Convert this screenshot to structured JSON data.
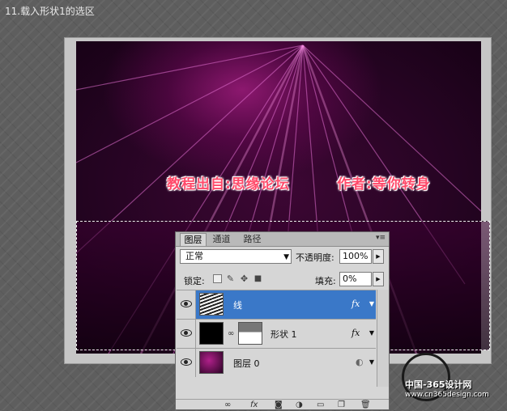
{
  "step_title": "11.载入形状1的选区",
  "canvas": {
    "caption_left": "教程出自:思缘论坛",
    "caption_right": "作者:等你转身"
  },
  "colors": {
    "canvas_dark": "#120111",
    "canvas_glow": "#dc28aa",
    "caption_red": "#ff4a6a",
    "selection_accent": "#3a78c8"
  },
  "layers_panel": {
    "tabs": [
      "图层",
      "通道",
      "路径"
    ],
    "active_tab": "图层",
    "blend_mode": "正常",
    "opacity_label": "不透明度:",
    "opacity_value": "100%",
    "lock_label": "锁定:",
    "fill_label": "填充:",
    "fill_value": "0%",
    "layers": [
      {
        "name": "线",
        "selected": true,
        "fx": "fx",
        "thumb": "line-pattern"
      },
      {
        "name": "形状 1",
        "selected": false,
        "fx": "fx",
        "thumb": "black-shape-with-mask"
      },
      {
        "name": "图层 0",
        "selected": false,
        "fx": "",
        "thumb": "magenta-image"
      }
    ],
    "footer_icons": [
      "link-icon",
      "fx-icon",
      "mask-icon",
      "adjustment-icon",
      "group-icon",
      "new-layer-icon",
      "delete-icon"
    ]
  },
  "watermark": {
    "title": "中国-365设计网",
    "url": "www.cn365design.com"
  }
}
